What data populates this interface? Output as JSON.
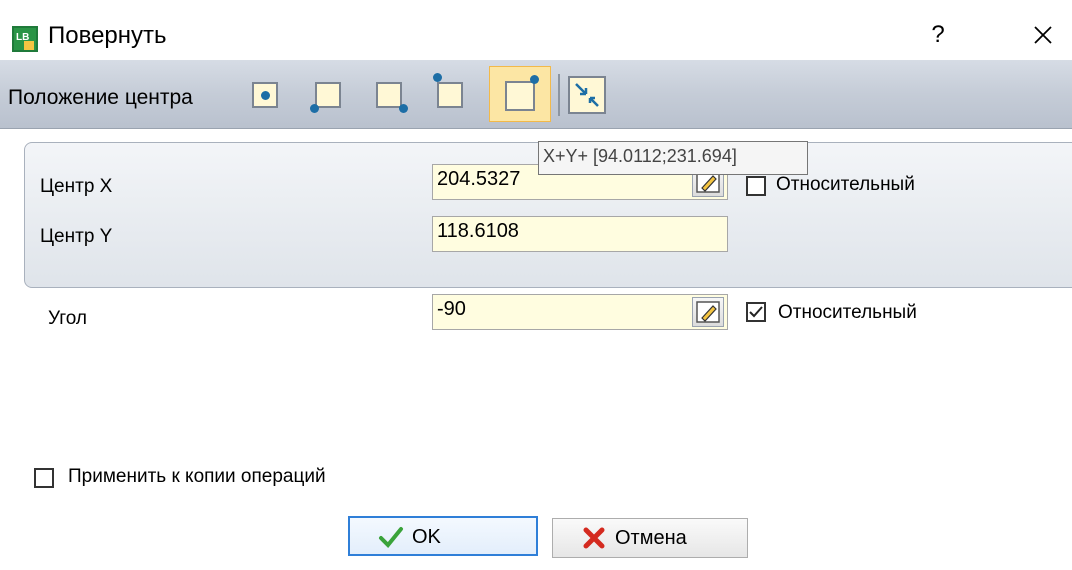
{
  "window": {
    "title": "Повернуть",
    "help": "?",
    "app_icon_text": "LB"
  },
  "toolbar": {
    "label": "Положение центра",
    "buttons": [
      {
        "name": "center",
        "selected": false
      },
      {
        "name": "bottom-left",
        "selected": false
      },
      {
        "name": "bottom-right",
        "selected": false
      },
      {
        "name": "top-left",
        "selected": false
      },
      {
        "name": "top-right",
        "selected": true
      }
    ]
  },
  "tooltip": {
    "text": "X+Y+ [94.0112;231.694]"
  },
  "center": {
    "x_label": "Центр X",
    "x_value": "204.5327",
    "y_label": "Центр Y",
    "y_value": "118.6108",
    "relative_label": "Относительный",
    "relative_checked": false
  },
  "angle": {
    "label": "Угол",
    "value": "-90",
    "relative_label": "Относительный",
    "relative_checked": true
  },
  "apply_copy": {
    "label": "Применить к копии операций",
    "checked": false
  },
  "buttons": {
    "ok": "OK",
    "cancel": "Отмена"
  },
  "colors": {
    "accent": "#2f7fd8",
    "toolbar_active": "#fce6a4",
    "input_bg": "#fffde0",
    "dot": "#1d6ea6"
  }
}
